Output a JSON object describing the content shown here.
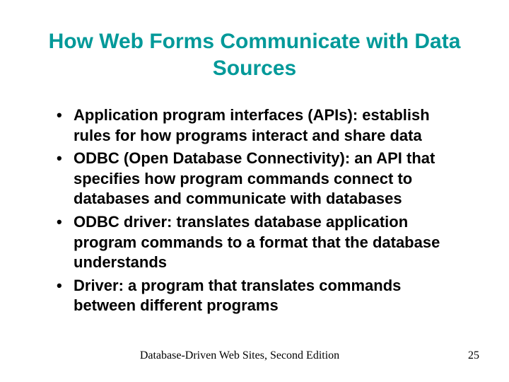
{
  "title": "How Web Forms Communicate with Data Sources",
  "bullets": [
    "Application program interfaces (APIs): establish rules for how programs interact and share data",
    "ODBC (Open Database Connectivity): an API that specifies how program commands connect to databases and communicate with databases",
    "ODBC driver: translates database application program commands to a format that the database understands",
    "Driver: a program that translates commands between different programs"
  ],
  "footer": {
    "text": "Database-Driven Web Sites, Second Edition",
    "page": "25"
  }
}
